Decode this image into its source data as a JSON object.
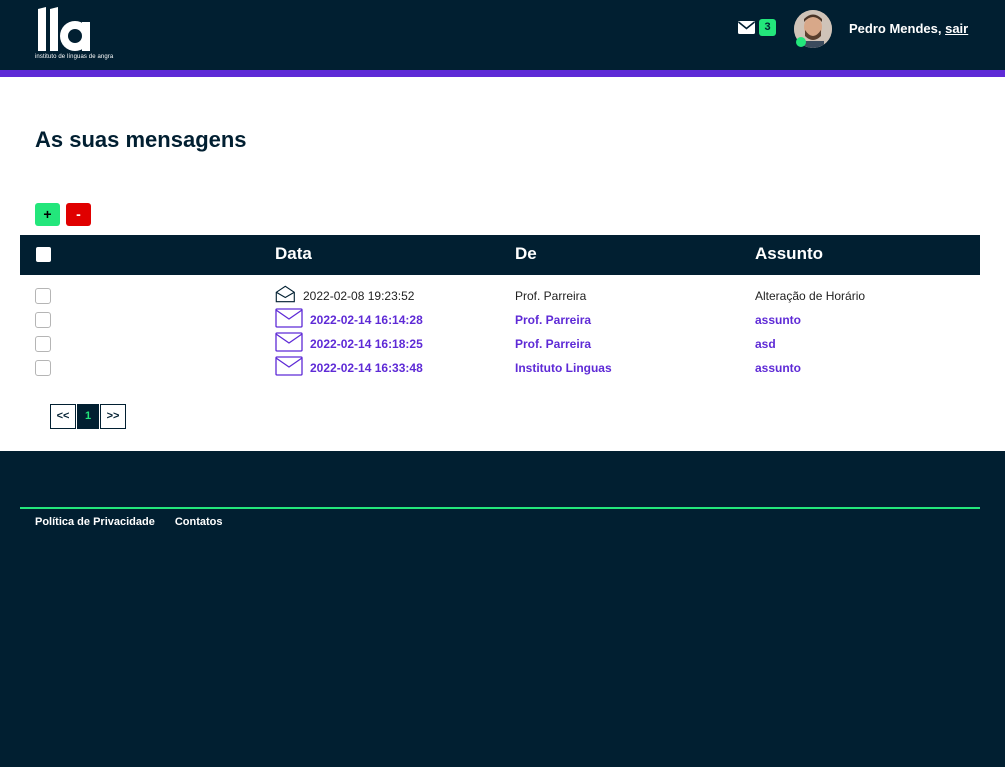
{
  "brand": {
    "logo_tagline": "instituto de línguas de angra"
  },
  "header": {
    "unread_count": "3",
    "user_name": "Pedro Mendes,",
    "logout_label": "sair"
  },
  "main": {
    "title": "As suas mensagens",
    "add_label": "+",
    "remove_label": "-",
    "columns": {
      "date": "Data",
      "from": "De",
      "subject": "Assunto"
    },
    "messages": [
      {
        "date": "2022-02-08 19:23:52",
        "from": "Prof. Parreira",
        "subject": "Alteração de Horário",
        "status": "read"
      },
      {
        "date": "2022-02-14 16:14:28",
        "from": "Prof. Parreira",
        "subject": "assunto",
        "status": "unread"
      },
      {
        "date": "2022-02-14 16:18:25",
        "from": "Prof. Parreira",
        "subject": "asd",
        "status": "unread"
      },
      {
        "date": "2022-02-14 16:33:48",
        "from": "Instituto Linguas",
        "subject": "assunto",
        "status": "unread"
      }
    ],
    "pagination": {
      "prev": "<<",
      "current": "1",
      "next": ">>"
    }
  },
  "footer": {
    "privacy_label": "Política de Privacidade",
    "contacts_label": "Contatos"
  },
  "colors": {
    "navy": "#011f31",
    "purple": "#5e2ad6",
    "green": "#23e67b",
    "red": "#e00000"
  }
}
